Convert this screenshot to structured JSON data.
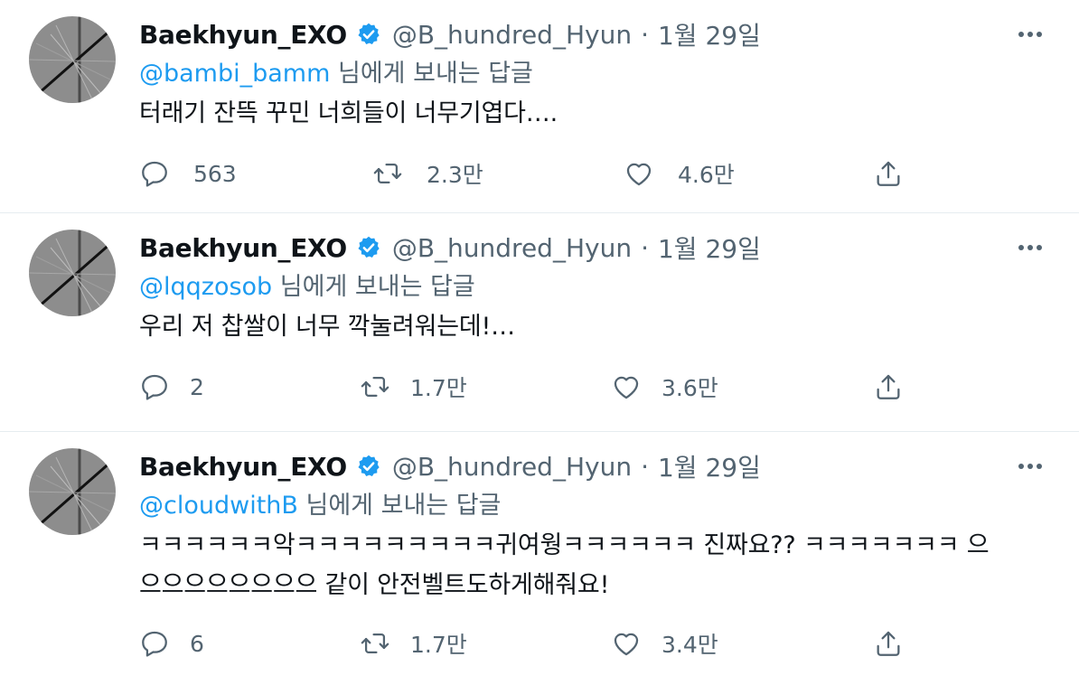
{
  "tweets": [
    {
      "name": "Baekhyun_EXO",
      "handle": "@B_hundred_Hyun",
      "separator": "·",
      "date": "1월 29일",
      "reply_mention": "@bambi_bamm",
      "reply_suffix": " 님에게 보내는 답글",
      "text": "터래기 잔뜩 꾸민 너희들이 너무기엽다….",
      "replies": "563",
      "retweets": "2.3만",
      "likes": "4.6만"
    },
    {
      "name": "Baekhyun_EXO",
      "handle": "@B_hundred_Hyun",
      "separator": "·",
      "date": "1월 29일",
      "reply_mention": "@lqqzosob",
      "reply_suffix": " 님에게 보내는 답글",
      "text": "우리 저 찹쌀이 너무 깍눌려워는데!…",
      "replies": "2",
      "retweets": "1.7만",
      "likes": "3.6만"
    },
    {
      "name": "Baekhyun_EXO",
      "handle": "@B_hundred_Hyun",
      "separator": "·",
      "date": "1월 29일",
      "reply_mention": "@cloudwithB",
      "reply_suffix": " 님에게 보내는 답글",
      "text_line1": "ㅋㅋㅋㅋㅋㅋ악ㅋㅋㅋㅋㅋㅋㅋㅋㅋ귀여웡ㅋㅋㅋㅋㅋㅋ 진짜요?? ㅋㅋㅋㅋㅋㅋㅋ 으",
      "text_line2": "으으으으으으으으 같이 안전벨트도하게해줘요!",
      "replies": "6",
      "retweets": "1.7만",
      "likes": "3.4만"
    }
  ],
  "icons": {
    "verified": "verified-badge-icon",
    "more": "more-options-icon",
    "reply": "reply-icon",
    "retweet": "retweet-icon",
    "like": "heart-icon",
    "share": "share-icon"
  },
  "colors": {
    "accent": "#1d9bf0",
    "muted": "#536471",
    "text": "#0f1419",
    "divider": "#e6ecf0"
  }
}
